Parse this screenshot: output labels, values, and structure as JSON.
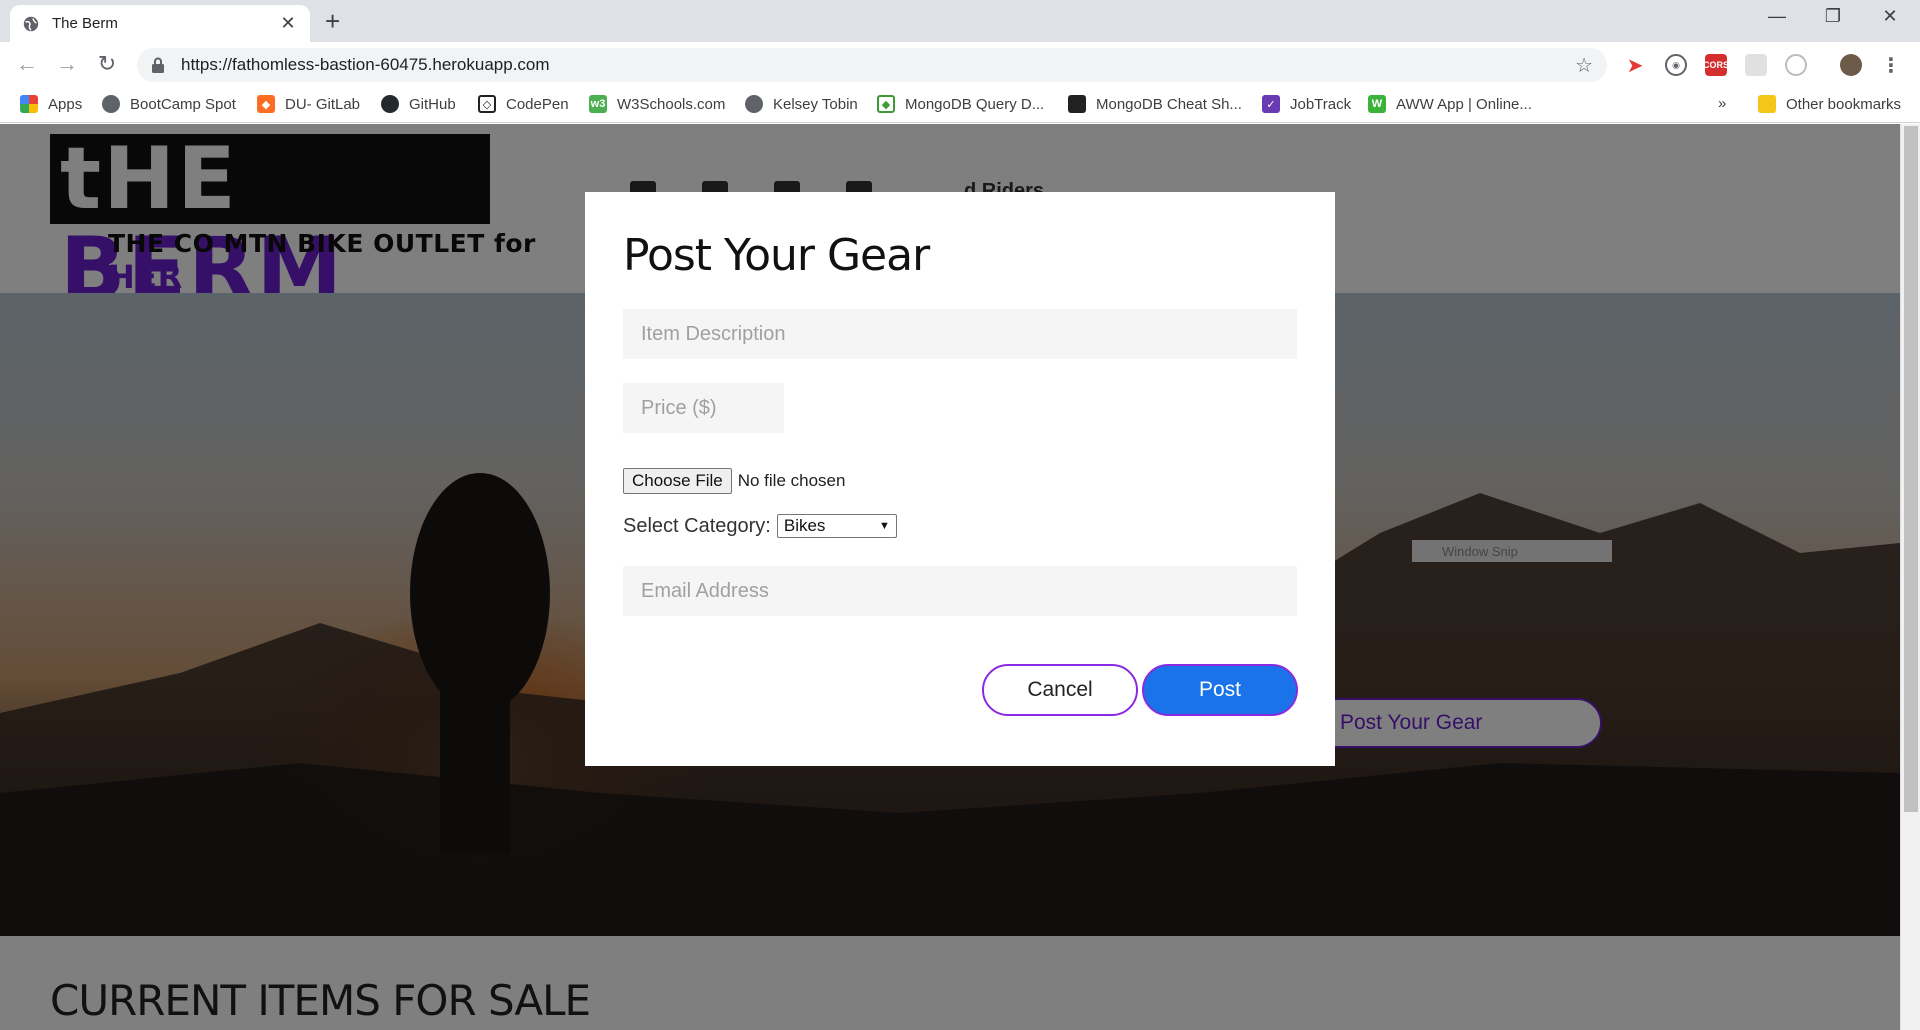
{
  "browser": {
    "tab_title": "The Berm",
    "url": "https://fathomless-bastion-60475.herokuapp.com",
    "bookmarks": [
      {
        "label": "Apps",
        "icon": "apps-grid-icon",
        "color": "#ea4335"
      },
      {
        "label": "BootCamp Spot",
        "icon": "globe-icon",
        "color": "#5f6368"
      },
      {
        "label": "DU- GitLab",
        "icon": "gitlab-icon",
        "color": "#fc6d26"
      },
      {
        "label": "GitHub",
        "icon": "github-icon",
        "color": "#24292e"
      },
      {
        "label": "CodePen",
        "icon": "codepen-icon",
        "color": "#222222"
      },
      {
        "label": "W3Schools.com",
        "icon": "w3schools-icon",
        "color": "#4caf50"
      },
      {
        "label": "Kelsey Tobin",
        "icon": "globe-icon",
        "color": "#5f6368"
      },
      {
        "label": "MongoDB Query D...",
        "icon": "mongodb-icon",
        "color": "#3f9c35"
      },
      {
        "label": "MongoDB Cheat Sh...",
        "icon": "doc-icon",
        "color": "#222222"
      },
      {
        "label": "JobTrack",
        "icon": "jobtrack-icon",
        "color": "#6a3ab2"
      },
      {
        "label": "AWW App | Online...",
        "icon": "aww-icon",
        "color": "#3bb33b"
      }
    ],
    "more_bookmarks": "»",
    "other_bookmarks": "Other bookmarks"
  },
  "site": {
    "logo_text_left": "tHE",
    "logo_text_right": "BERM",
    "tagline": "THE CO MTN BIKE OUTLET for",
    "tagline_her": "HER",
    "nav_visible_fragment": "d Riders",
    "hero_button": "Post Your Gear",
    "window_snip": "Window Snip",
    "items_title": "CURRENT ITEMS FOR SALE"
  },
  "modal": {
    "title": "Post Your Gear",
    "description_placeholder": "Item Description",
    "price_placeholder": "Price ($)",
    "file_button": "Choose File",
    "file_status": "No file chosen",
    "category_label": "Select Category:",
    "category_value": "Bikes",
    "email_placeholder": "Email Address",
    "cancel_label": "Cancel",
    "post_label": "Post"
  },
  "colors": {
    "brand_purple": "#6a1fd0",
    "post_blue": "#1a73e8",
    "cancel_border": "#8a2be2"
  }
}
